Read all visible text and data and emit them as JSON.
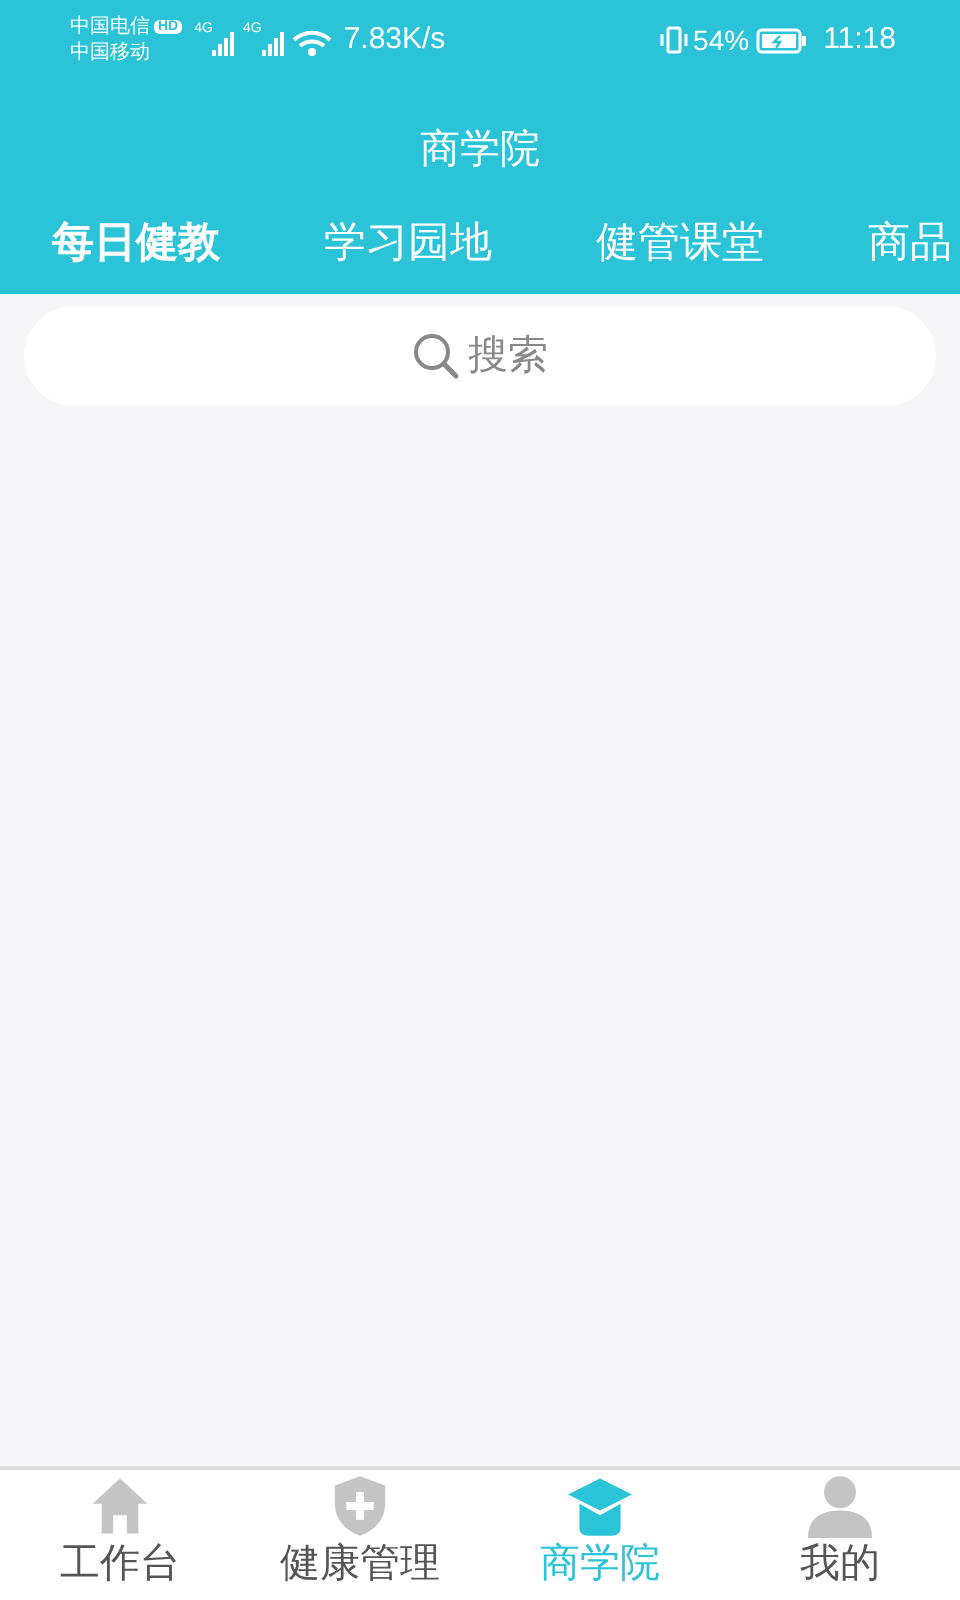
{
  "status_bar": {
    "carrier_1": "中国电信",
    "carrier_1_badge": "HD",
    "carrier_2": "中国移动",
    "network_1": "4G",
    "network_2": "4G",
    "speed": "7.83K/s",
    "battery": "54%",
    "time": "11:18"
  },
  "header": {
    "title": "商学院"
  },
  "tabs": [
    {
      "label": "每日健教",
      "selected": true
    },
    {
      "label": "学习园地",
      "selected": false
    },
    {
      "label": "健管课堂",
      "selected": false
    },
    {
      "label": "商品",
      "selected": false
    }
  ],
  "search": {
    "placeholder": "搜索"
  },
  "bottom_nav": [
    {
      "label": "工作台",
      "kind": "home",
      "selected": false
    },
    {
      "label": "健康管理",
      "kind": "shield",
      "selected": false
    },
    {
      "label": "商学院",
      "kind": "cap",
      "selected": true
    },
    {
      "label": "我的",
      "kind": "person",
      "selected": false
    }
  ]
}
